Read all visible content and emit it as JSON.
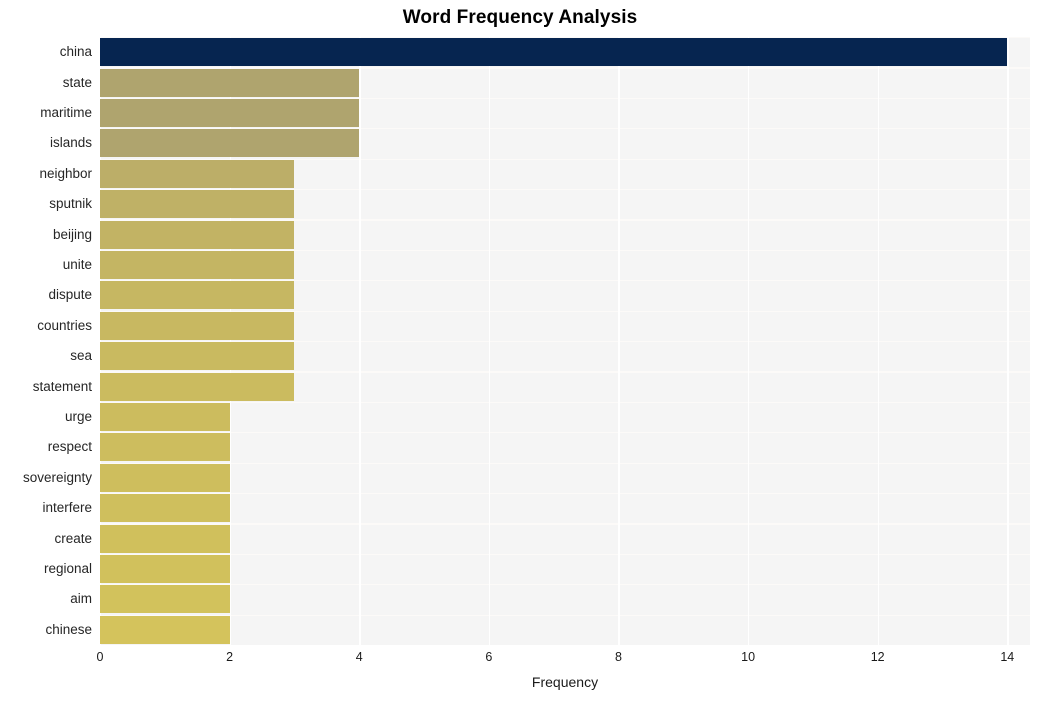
{
  "chart_data": {
    "type": "bar",
    "orientation": "horizontal",
    "title": "Word Frequency Analysis",
    "xlabel": "Frequency",
    "ylabel": "",
    "xlim": [
      0,
      14.35
    ],
    "xticks": [
      0,
      2,
      4,
      6,
      8,
      10,
      12,
      14
    ],
    "xticklabels": [
      "0",
      "2",
      "4",
      "6",
      "8",
      "10",
      "12",
      "14"
    ],
    "grid": true,
    "legend": null,
    "categories": [
      "china",
      "state",
      "maritime",
      "islands",
      "neighbor",
      "sputnik",
      "beijing",
      "unite",
      "dispute",
      "countries",
      "sea",
      "statement",
      "urge",
      "respect",
      "sovereignty",
      "interfere",
      "create",
      "regional",
      "aim",
      "chinese"
    ],
    "values": [
      14,
      4,
      4,
      4,
      3,
      3,
      3,
      3,
      3,
      3,
      3,
      3,
      2,
      2,
      2,
      2,
      2,
      2,
      2,
      2
    ],
    "bar_colors": [
      "#062550",
      "#afa46e",
      "#afa46e",
      "#afa46e",
      "#bcae68",
      "#bfb166",
      "#c2b364",
      "#c4b563",
      "#c6b762",
      "#c8b861",
      "#c9ba60",
      "#cbbb5f",
      "#ccbc5e",
      "#cdbd5e",
      "#cebe5d",
      "#cfbf5d",
      "#d0c05c",
      "#d1c15c",
      "#d2c25c",
      "#d4c35c"
    ],
    "plot_background": "#f5f5f5",
    "gridline_color": "#ffffff",
    "figure_background": "#ffffff",
    "title_color": "#000000"
  }
}
